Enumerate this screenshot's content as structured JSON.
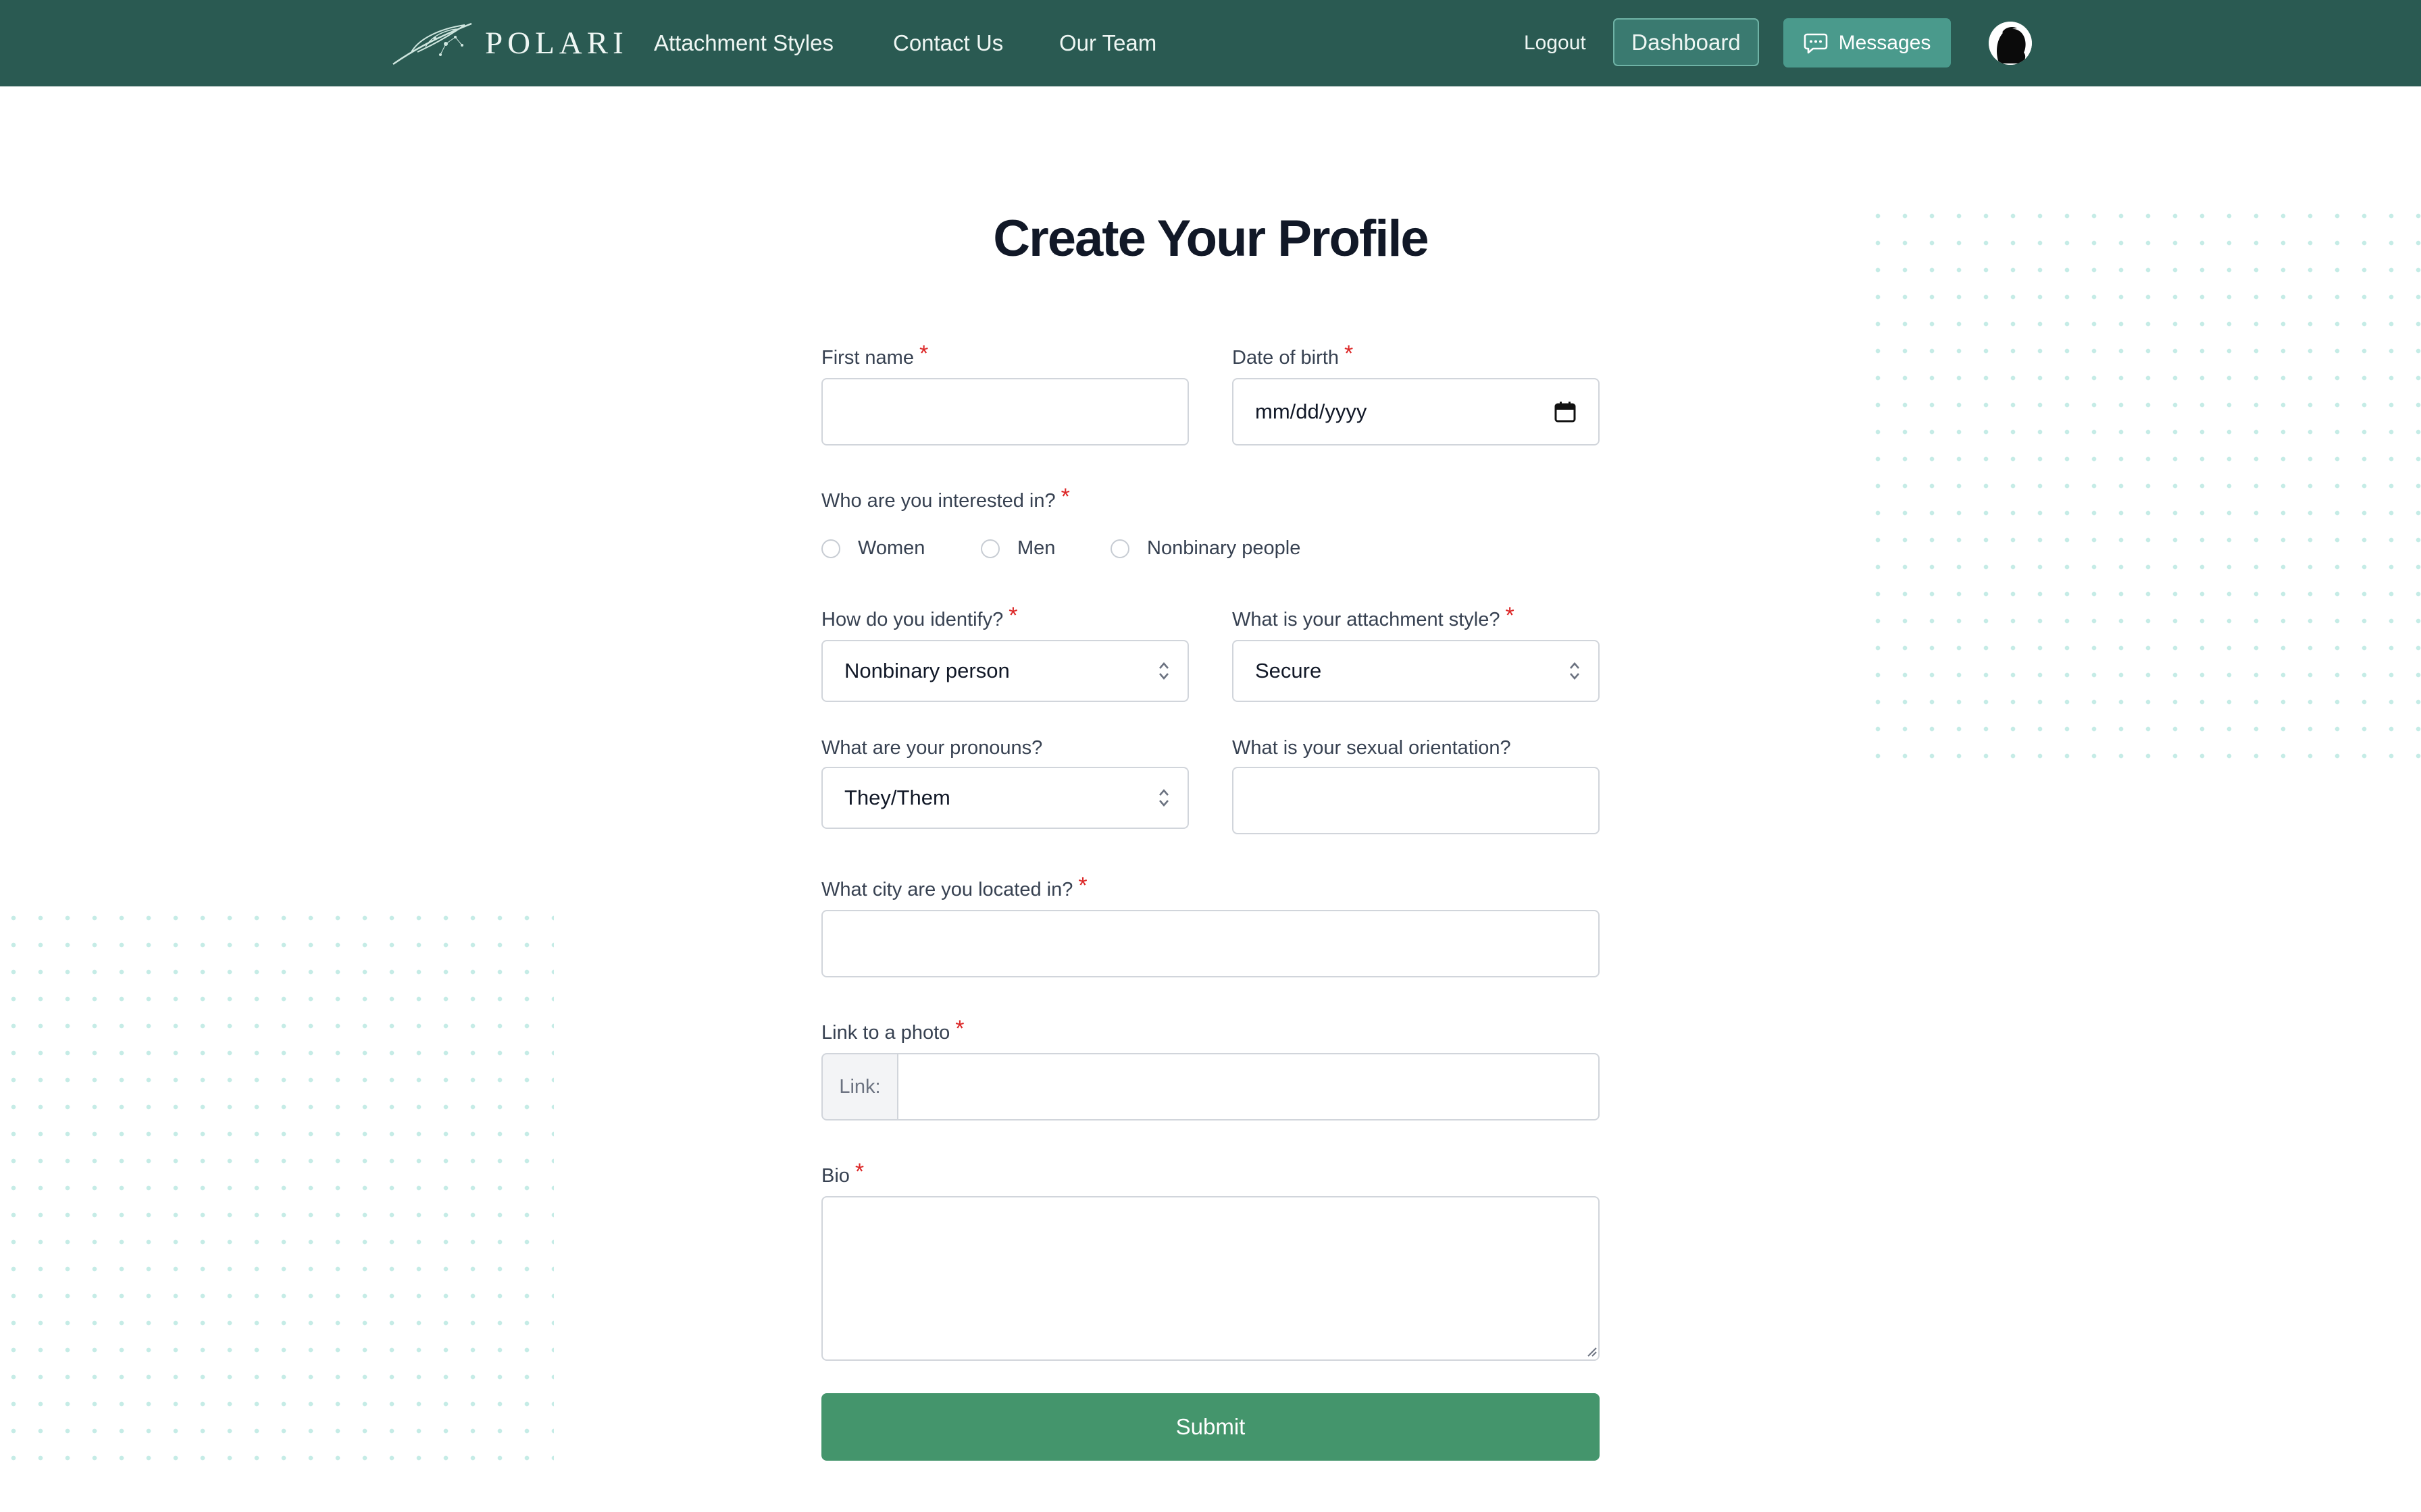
{
  "nav": {
    "logo_text": "POLARI",
    "links": [
      "Attachment Styles",
      "Contact Us",
      "Our Team"
    ],
    "logout_label": "Logout",
    "dashboard_label": "Dashboard",
    "messages_label": "Messages",
    "icons": {
      "messages": "chat-bubble-icon",
      "avatar": "user-avatar-icon",
      "logo": "feather-logo-icon"
    }
  },
  "page": {
    "title": "Create Your Profile"
  },
  "form": {
    "first_name": {
      "label": "First name",
      "required": "*",
      "value": ""
    },
    "dob": {
      "label": "Date of birth",
      "required": "*",
      "placeholder": "mm/dd/yyyy"
    },
    "interested": {
      "label": "Who are you interested in?",
      "required": "*",
      "options": [
        "Women",
        "Men",
        "Nonbinary people"
      ]
    },
    "identify": {
      "label": "How do you identify?",
      "required": "*",
      "selected": "Nonbinary person"
    },
    "attachment": {
      "label": "What is your attachment style?",
      "required": "*",
      "selected": "Secure"
    },
    "pronouns": {
      "label": "What are your pronouns?",
      "selected": "They/Them"
    },
    "orientation": {
      "label": "What is your sexual orientation?",
      "value": ""
    },
    "city": {
      "label": "What city are you located in?",
      "required": "*",
      "value": ""
    },
    "photo": {
      "label": "Link to a photo",
      "required": "*",
      "prefix": "Link:",
      "value": ""
    },
    "bio": {
      "label": "Bio",
      "required": "*",
      "value": ""
    },
    "submit_label": "Submit"
  },
  "colors": {
    "nav_bg": "#2a5a52",
    "dashboard_bg": "#3a7a70",
    "messages_bg": "#4a9a8c",
    "submit_bg": "#44956c",
    "required": "#dc2626",
    "dots": "#c5ece6"
  }
}
